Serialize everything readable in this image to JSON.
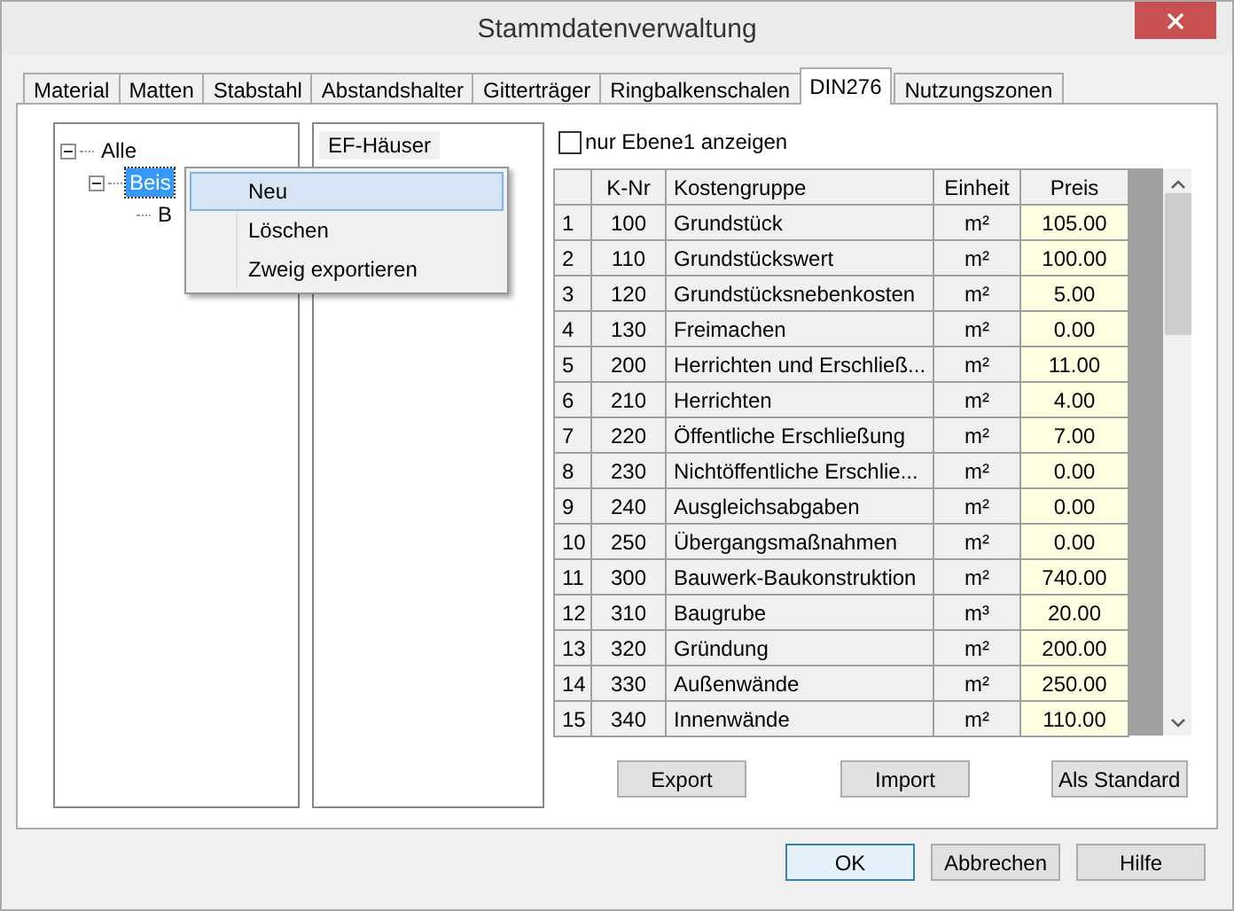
{
  "window": {
    "title": "Stammdatenverwaltung"
  },
  "tabs": [
    {
      "label": "Material",
      "selected": false
    },
    {
      "label": "Matten",
      "selected": false
    },
    {
      "label": "Stabstahl",
      "selected": false
    },
    {
      "label": "Abstandshalter",
      "selected": false
    },
    {
      "label": "Gitterträger",
      "selected": false
    },
    {
      "label": "Ringbalkenschalen",
      "selected": false
    },
    {
      "label": "DIN276",
      "selected": true
    },
    {
      "label": "Nutzungszonen",
      "selected": false
    }
  ],
  "tree": [
    {
      "label": "Alle",
      "expanded": true,
      "selected": false,
      "children": [
        {
          "label": "Beis",
          "expanded": true,
          "selected": true,
          "children": [
            {
              "label": "B",
              "selected": false
            }
          ]
        }
      ]
    }
  ],
  "list_panel": {
    "header": "EF-Häuser"
  },
  "context_menu": [
    {
      "label": "Neu",
      "selected": true
    },
    {
      "label": "Löschen",
      "selected": false
    },
    {
      "label": "Zweig exportieren",
      "selected": false
    }
  ],
  "filter_checkbox": {
    "label": "nur Ebene1 anzeigen",
    "checked": false
  },
  "table": {
    "columns": [
      "K-Nr",
      "Kostengruppe",
      "Einheit",
      "Preis"
    ],
    "rows": [
      {
        "index": "1",
        "k_nr": "100",
        "kostengruppe": "Grundstück",
        "einheit": "m²",
        "preis": "105.00"
      },
      {
        "index": "2",
        "k_nr": "110",
        "kostengruppe": "Grundstückswert",
        "einheit": "m²",
        "preis": "100.00"
      },
      {
        "index": "3",
        "k_nr": "120",
        "kostengruppe": "Grundstücksnebenkosten",
        "einheit": "m²",
        "preis": "5.00"
      },
      {
        "index": "4",
        "k_nr": "130",
        "kostengruppe": "Freimachen",
        "einheit": "m²",
        "preis": "0.00"
      },
      {
        "index": "5",
        "k_nr": "200",
        "kostengruppe": "Herrichten und Erschließ...",
        "einheit": "m²",
        "preis": "11.00"
      },
      {
        "index": "6",
        "k_nr": "210",
        "kostengruppe": "Herrichten",
        "einheit": "m²",
        "preis": "4.00"
      },
      {
        "index": "7",
        "k_nr": "220",
        "kostengruppe": "Öffentliche Erschließung",
        "einheit": "m²",
        "preis": "7.00"
      },
      {
        "index": "8",
        "k_nr": "230",
        "kostengruppe": "Nichtöffentliche Erschlie...",
        "einheit": "m²",
        "preis": "0.00"
      },
      {
        "index": "9",
        "k_nr": "240",
        "kostengruppe": "Ausgleichsabgaben",
        "einheit": "m²",
        "preis": "0.00"
      },
      {
        "index": "10",
        "k_nr": "250",
        "kostengruppe": "Übergangsmaßnahmen",
        "einheit": "m²",
        "preis": "0.00"
      },
      {
        "index": "11",
        "k_nr": "300",
        "kostengruppe": "Bauwerk-Baukonstruktion",
        "einheit": "m²",
        "preis": "740.00"
      },
      {
        "index": "12",
        "k_nr": "310",
        "kostengruppe": "Baugrube",
        "einheit": "m³",
        "preis": "20.00"
      },
      {
        "index": "13",
        "k_nr": "320",
        "kostengruppe": "Gründung",
        "einheit": "m²",
        "preis": "200.00"
      },
      {
        "index": "14",
        "k_nr": "330",
        "kostengruppe": "Außenwände",
        "einheit": "m²",
        "preis": "250.00"
      },
      {
        "index": "15",
        "k_nr": "340",
        "kostengruppe": "Innenwände",
        "einheit": "m²",
        "preis": "110.00"
      }
    ]
  },
  "table_buttons": [
    {
      "label": "Export"
    },
    {
      "label": "Import"
    },
    {
      "label": "Als Standard"
    }
  ],
  "dialog_buttons": [
    {
      "label": "OK",
      "focused": true
    },
    {
      "label": "Abbrechen",
      "focused": false
    },
    {
      "label": "Hilfe",
      "focused": false
    }
  ]
}
